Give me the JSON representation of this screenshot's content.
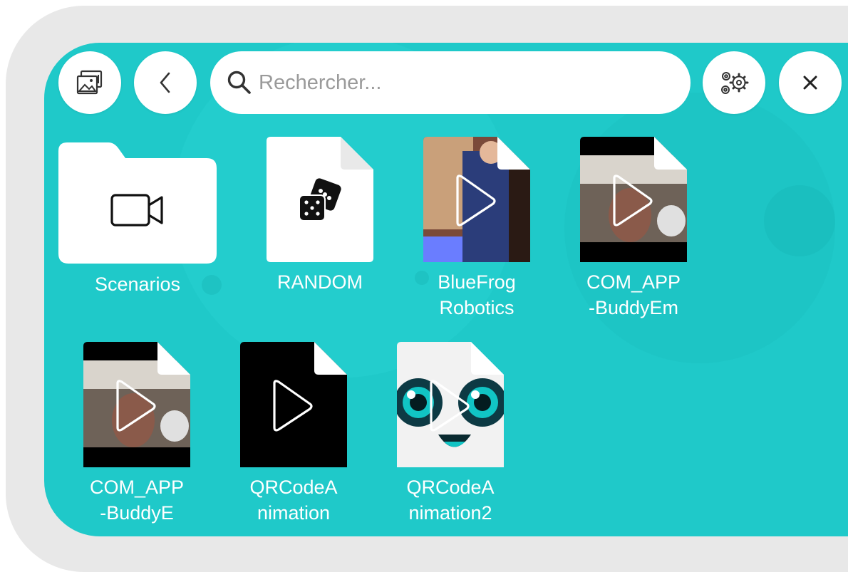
{
  "toolbar": {
    "gallery_icon": "gallery-icon",
    "back_icon": "chevron-left-icon",
    "search_icon": "search-icon",
    "settings_icon": "gears-icon",
    "close_icon": "close-icon"
  },
  "search": {
    "placeholder": "Rechercher..."
  },
  "items": [
    {
      "label": "Scenarios",
      "type": "folder",
      "icon": "video-camera-icon"
    },
    {
      "label": "RANDOM",
      "type": "file",
      "icon": "dice-icon"
    },
    {
      "label": "BlueFrog\nRobotics",
      "type": "video",
      "icon": "play-icon"
    },
    {
      "label": "COM_APP\n-BuddyEm",
      "type": "video",
      "icon": "play-icon"
    },
    {
      "label": "COM_APP\n-BuddyE",
      "type": "video",
      "icon": "play-icon"
    },
    {
      "label": "QRCodeA\nnimation",
      "type": "video",
      "icon": "play-icon"
    },
    {
      "label": "QRCodeA\nnimation2",
      "type": "video",
      "icon": "play-icon"
    }
  ],
  "colors": {
    "background": "#1fc9c9",
    "frame": "#e8e8e8",
    "tile": "#ffffff"
  }
}
